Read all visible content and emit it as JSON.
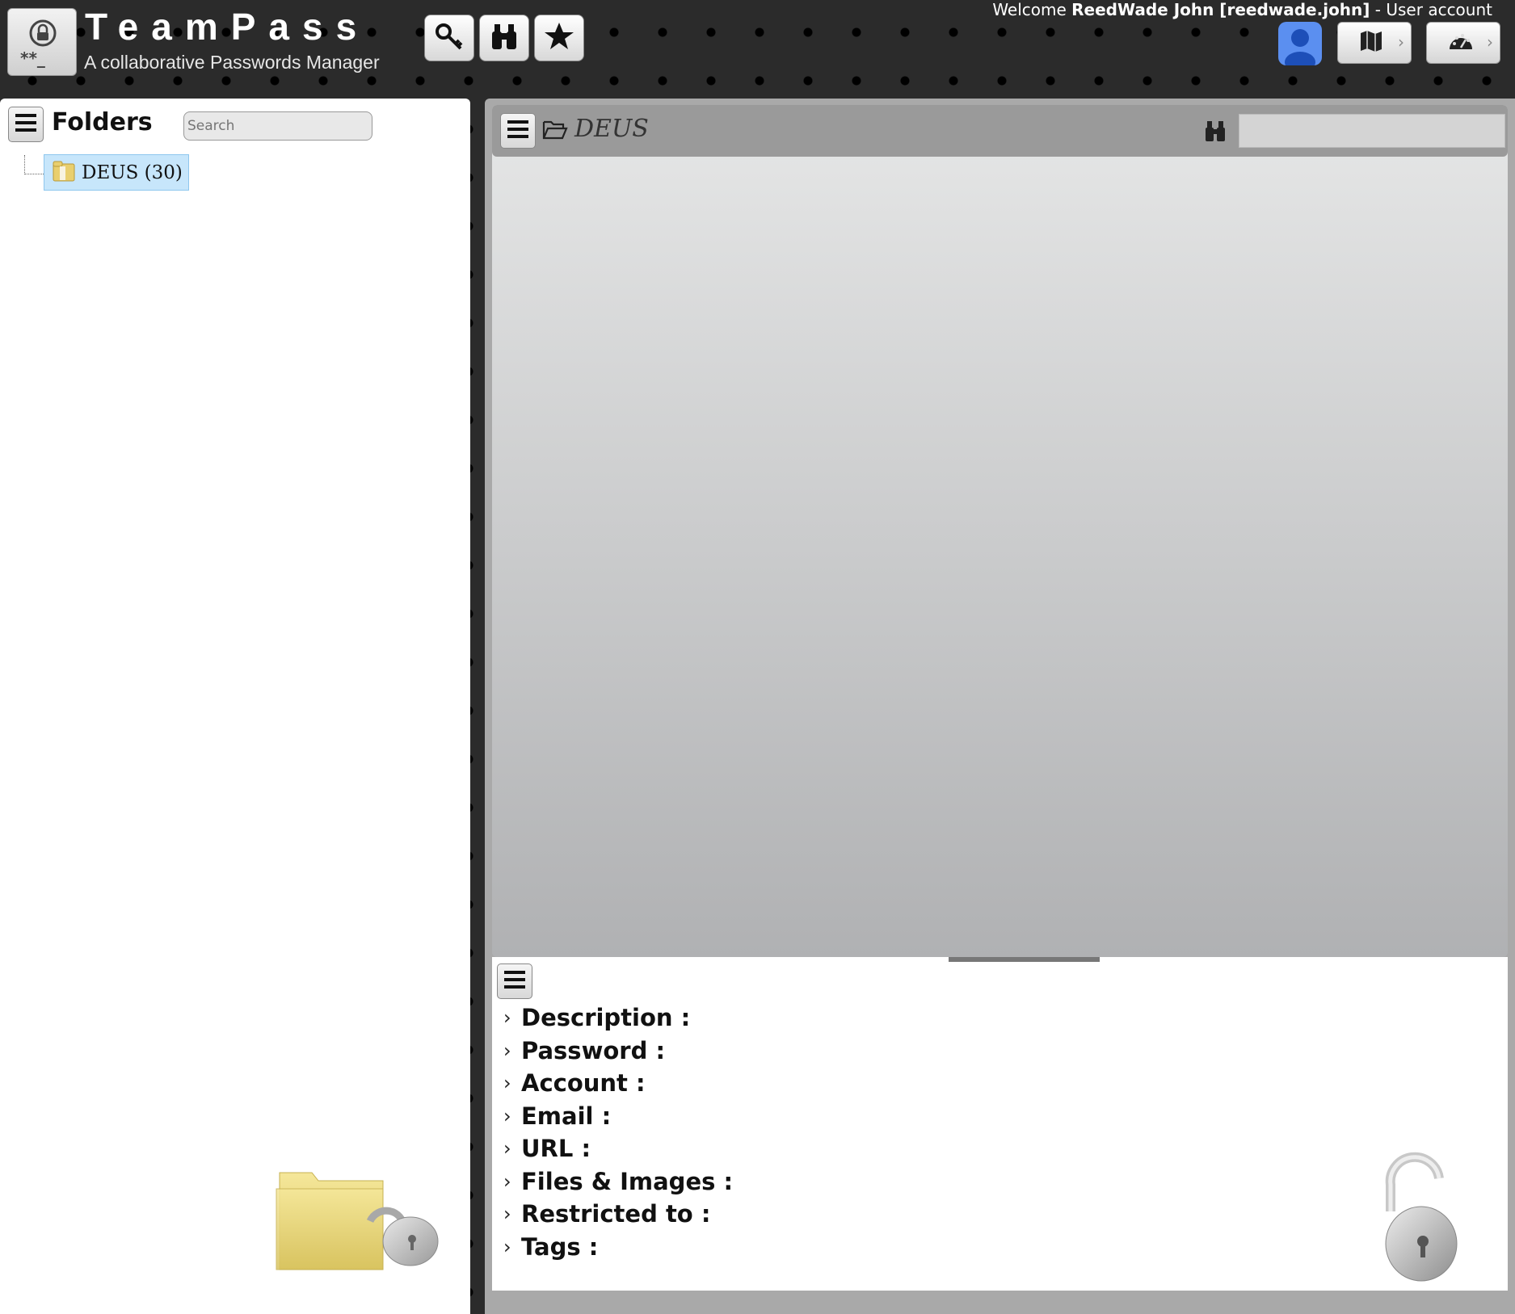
{
  "header": {
    "brand_title": "TeamPass",
    "brand_subtitle": "A collaborative Passwords Manager",
    "welcome_prefix": "Welcome ",
    "welcome_user": "ReedWade John [reedwade.john]",
    "welcome_suffix": " - User account",
    "icons": [
      "key-icon",
      "binoculars-icon",
      "star-icon",
      "user-icon",
      "map-icon",
      "dashboard-icon"
    ]
  },
  "folders_panel": {
    "title": "Folders",
    "search_placeholder": "Search",
    "tree": [
      {
        "label": "DEUS (30)",
        "selected": true
      }
    ]
  },
  "items_panel": {
    "folder_name": "DEUS",
    "search_value": ""
  },
  "details_panel": {
    "fields": [
      "Description :",
      "Password :",
      "Account :",
      "Email :",
      "URL :",
      "Files & Images :",
      "Restricted to :",
      "Tags :"
    ]
  },
  "colors": {
    "selected_node_bg": "#c7e6fb",
    "avatar_bg": "#5b8ff0",
    "header_bar_bg": "#9a9a9a"
  }
}
